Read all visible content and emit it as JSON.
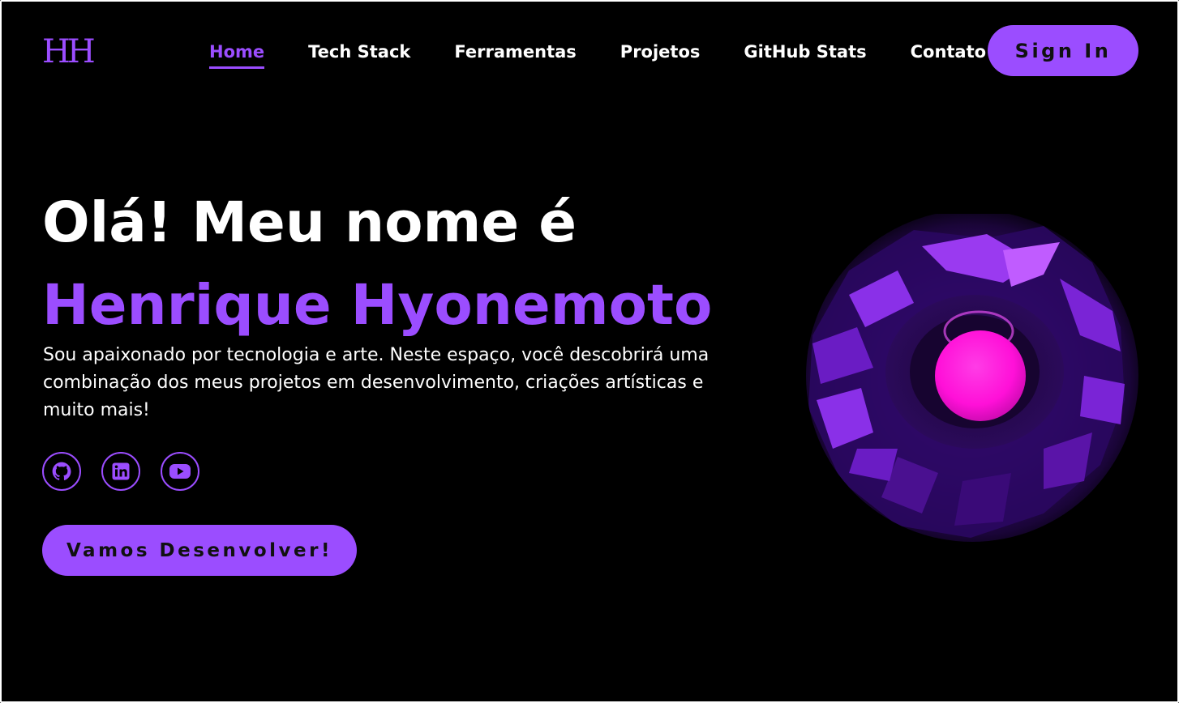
{
  "header": {
    "logo": "HH",
    "nav": [
      {
        "label": "Home",
        "active": true
      },
      {
        "label": "Tech Stack",
        "active": false
      },
      {
        "label": "Ferramentas",
        "active": false
      },
      {
        "label": "Projetos",
        "active": false
      },
      {
        "label": "GitHub Stats",
        "active": false
      },
      {
        "label": "Contato",
        "active": false
      }
    ],
    "signin_label": "Sign In"
  },
  "hero": {
    "greeting": "Olá! Meu nome é",
    "name": "Henrique Hyonemoto",
    "description": "Sou apaixonado por tecnologia e arte. Neste espaço, você descobrirá uma combinação dos meus projetos em desenvolvimento, criações artísticas e muito mais!",
    "cta_label": "Vamos Desenvolver!",
    "socials": [
      {
        "name": "github",
        "icon": "github-icon"
      },
      {
        "name": "linkedin",
        "icon": "linkedin-icon"
      },
      {
        "name": "youtube",
        "icon": "youtube-icon"
      }
    ]
  },
  "colors": {
    "accent": "#9b4dff",
    "background": "#000000",
    "text": "#ffffff",
    "orb": "#ff10d8"
  }
}
